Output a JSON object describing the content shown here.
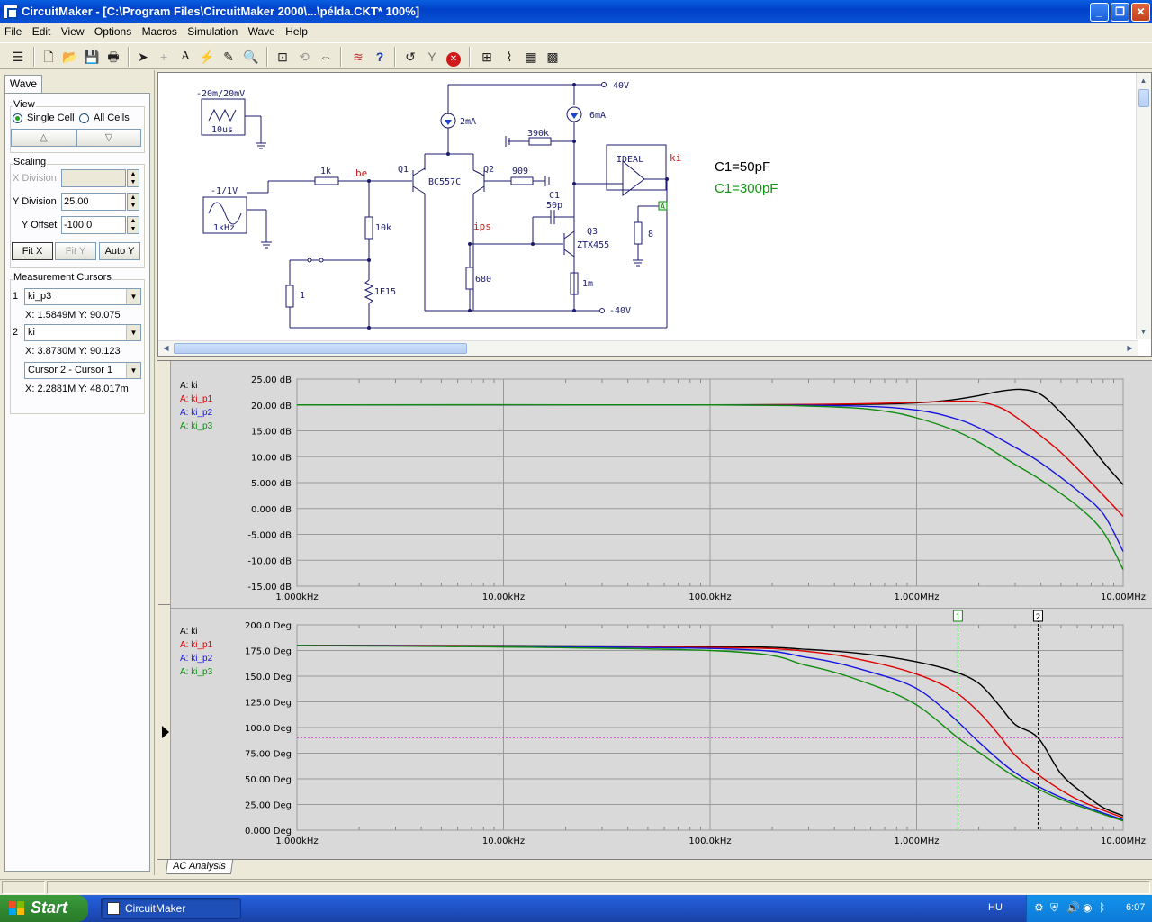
{
  "window": {
    "title": "CircuitMaker - [C:\\Program Files\\CircuitMaker 2000\\...\\példa.CKT* 100%]"
  },
  "menu": [
    "File",
    "Edit",
    "View",
    "Options",
    "Macros",
    "Simulation",
    "Wave",
    "Help"
  ],
  "left_panel": {
    "tab": "Wave",
    "view": {
      "title": "View",
      "single_cell": "Single Cell",
      "all_cells": "All Cells",
      "up_glyph": "△",
      "down_glyph": "▽"
    },
    "scaling": {
      "title": "Scaling",
      "x_division_label": "X Division",
      "x_division_value": "",
      "y_division_label": "Y Division",
      "y_division_value": "25.00",
      "y_offset_label": "Y Offset",
      "y_offset_value": "-100.0",
      "fit_x": "Fit X",
      "fit_y": "Fit Y",
      "auto_y": "Auto Y"
    },
    "cursors": {
      "title": "Measurement Cursors",
      "c1_index": "1",
      "c1_value": "ki_p3",
      "c1_readout": "X: 1.5849M  Y: 90.075",
      "c2_index": "2",
      "c2_value": "ki",
      "c2_readout": "X: 3.8730M  Y: 90.123",
      "diff_value": "Cursor 2 - Cursor 1",
      "diff_readout": "X: 2.2881M  Y: 48.017m"
    }
  },
  "schematic": {
    "annotation1": "C1=50pF",
    "annotation2": "C1=300pF",
    "annotation1_color": "#000000",
    "annotation2_color": "#129612",
    "gen1_label": "-20m/20mV",
    "gen1_time": "10us",
    "gen2_label": "-1/1V",
    "gen2_freq": "1kHz",
    "labels": {
      "r1k": "1k",
      "be": "be",
      "q1": "Q1",
      "bc557c": "BC557C",
      "q2": "Q2",
      "r909": "909",
      "r390k": "390k",
      "i2ma": "2mA",
      "i6ma": "6mA",
      "v40": "40V",
      "vm40": "-40V",
      "c1": "C1",
      "c1v": "50p",
      "q3": "Q3",
      "ztx": "ZTX455",
      "ips": "ips",
      "r10k": "10k",
      "r1e15": "1E15",
      "r1": "1",
      "r680": "680",
      "r1m": "1m",
      "r8": "8",
      "ideal": "IDEAL",
      "ki": "ki",
      "probe": "A"
    }
  },
  "wave": {
    "tab": "AC Analysis",
    "top_legend": [
      "A: ki",
      "A: ki_p1",
      "A: ki_p2",
      "A: ki_p3"
    ],
    "bottom_legend": [
      "A: ki",
      "A: ki_p1",
      "A: ki_p2",
      "A: ki_p3"
    ],
    "legend_colors": [
      "#000000",
      "#e00000",
      "#1414e0",
      "#0f8c0f"
    ],
    "cursor_markers": [
      "1",
      "2"
    ]
  },
  "chart_data": [
    {
      "type": "line",
      "xscale": "log",
      "xlim": [
        1000,
        10000000
      ],
      "ylim": [
        -15,
        25
      ],
      "yticks": [
        "25.00 dB",
        "20.00 dB",
        "15.00 dB",
        "10.00 dB",
        "5.000 dB",
        "0.000 dB",
        "-5.000 dB",
        "-10.00 dB",
        "-15.00 dB"
      ],
      "xticks": [
        "1.000kHz",
        "10.00kHz",
        "100.0kHz",
        "1.000MHz",
        "10.00MHz"
      ],
      "grid": true,
      "legend": "top-left",
      "series": [
        {
          "name": "A: ki",
          "color": "#000000",
          "points": [
            [
              1000,
              20.0
            ],
            [
              100000,
              20.0
            ],
            [
              500000,
              20.1
            ],
            [
              1000000,
              20.4
            ],
            [
              1500000,
              21.0
            ],
            [
              2000000,
              21.8
            ],
            [
              2500000,
              22.6
            ],
            [
              3200000,
              23.0
            ],
            [
              4000000,
              22.0
            ],
            [
              5000000,
              18.5
            ],
            [
              6500000,
              13.5
            ],
            [
              8000000,
              9.0
            ],
            [
              10000000,
              4.6
            ]
          ]
        },
        {
          "name": "A: ki_p1",
          "color": "#e00000",
          "points": [
            [
              1000,
              20.0
            ],
            [
              100000,
              20.0
            ],
            [
              500000,
              20.2
            ],
            [
              1000000,
              20.5
            ],
            [
              1500000,
              20.7
            ],
            [
              2000000,
              20.6
            ],
            [
              2500000,
              19.6
            ],
            [
              3000000,
              17.8
            ],
            [
              4000000,
              14.0
            ],
            [
              5000000,
              10.8
            ],
            [
              7000000,
              5.0
            ],
            [
              10000000,
              -1.5
            ]
          ]
        },
        {
          "name": "A: ki_p2",
          "color": "#1414e0",
          "points": [
            [
              1000,
              20.0
            ],
            [
              100000,
              20.0
            ],
            [
              500000,
              19.8
            ],
            [
              1000000,
              19.0
            ],
            [
              1500000,
              17.5
            ],
            [
              2000000,
              15.6
            ],
            [
              3000000,
              11.8
            ],
            [
              4000000,
              8.8
            ],
            [
              6000000,
              3.5
            ],
            [
              8000000,
              -1.0
            ],
            [
              10000000,
              -8.3
            ]
          ]
        },
        {
          "name": "A: ki_p3",
          "color": "#0f8c0f",
          "points": [
            [
              1000,
              20.0
            ],
            [
              100000,
              20.0
            ],
            [
              400000,
              19.6
            ],
            [
              700000,
              18.8
            ],
            [
              1000000,
              17.5
            ],
            [
              1500000,
              15.2
            ],
            [
              2000000,
              12.8
            ],
            [
              3000000,
              8.5
            ],
            [
              4000000,
              5.5
            ],
            [
              6000000,
              0.5
            ],
            [
              8000000,
              -4.5
            ],
            [
              10000000,
              -11.8
            ]
          ]
        }
      ]
    },
    {
      "type": "line",
      "xscale": "log",
      "xlim": [
        1000,
        10000000
      ],
      "ylim": [
        0,
        200
      ],
      "yticks": [
        "200.0 Deg",
        "175.0 Deg",
        "150.0 Deg",
        "125.0 Deg",
        "100.0 Deg",
        "75.00 Deg",
        "50.00 Deg",
        "25.00 Deg",
        "0.000 Deg"
      ],
      "xticks": [
        "1.000kHz",
        "10.00kHz",
        "100.0kHz",
        "1.000MHz",
        "10.00MHz"
      ],
      "grid": true,
      "legend": "top-left",
      "reference_line": 90,
      "cursors": [
        1584900,
        3873000
      ],
      "series": [
        {
          "name": "A: ki",
          "color": "#000000",
          "points": [
            [
              1000,
              180
            ],
            [
              100000,
              179
            ],
            [
              300000,
              176
            ],
            [
              600000,
              171
            ],
            [
              1000000,
              164
            ],
            [
              1500000,
              155
            ],
            [
              2000000,
              143
            ],
            [
              2500000,
              122
            ],
            [
              3000000,
              103
            ],
            [
              3873000,
              90
            ],
            [
              5000000,
              55
            ],
            [
              6500000,
              35
            ],
            [
              8000000,
              22
            ],
            [
              10000000,
              14
            ]
          ]
        },
        {
          "name": "A: ki_p1",
          "color": "#e00000",
          "points": [
            [
              1000,
              180
            ],
            [
              100000,
              178
            ],
            [
              300000,
              174
            ],
            [
              600000,
              164
            ],
            [
              1000000,
              152
            ],
            [
              1500000,
              136
            ],
            [
              2000000,
              115
            ],
            [
              2500000,
              93
            ],
            [
              3000000,
              73
            ],
            [
              4000000,
              52
            ],
            [
              6000000,
              30
            ],
            [
              10000000,
              12
            ]
          ]
        },
        {
          "name": "A: ki_p2",
          "color": "#1414e0",
          "points": [
            [
              1000,
              180
            ],
            [
              100000,
              177
            ],
            [
              300000,
              168
            ],
            [
              600000,
              154
            ],
            [
              1000000,
              138
            ],
            [
              1500000,
              110
            ],
            [
              2000000,
              86
            ],
            [
              3000000,
              56
            ],
            [
              5000000,
              32
            ],
            [
              10000000,
              10
            ]
          ]
        },
        {
          "name": "A: ki_p3",
          "color": "#0f8c0f",
          "points": [
            [
              1000,
              180
            ],
            [
              100000,
              175
            ],
            [
              300000,
              160
            ],
            [
              600000,
              142
            ],
            [
              1000000,
              122
            ],
            [
              1584900,
              90
            ],
            [
              2000000,
              76
            ],
            [
              3000000,
              52
            ],
            [
              5000000,
              30
            ],
            [
              10000000,
              9
            ]
          ]
        }
      ]
    }
  ],
  "taskbar": {
    "start": "Start",
    "item": "CircuitMaker",
    "lang": "HU",
    "clock": "6:07"
  }
}
